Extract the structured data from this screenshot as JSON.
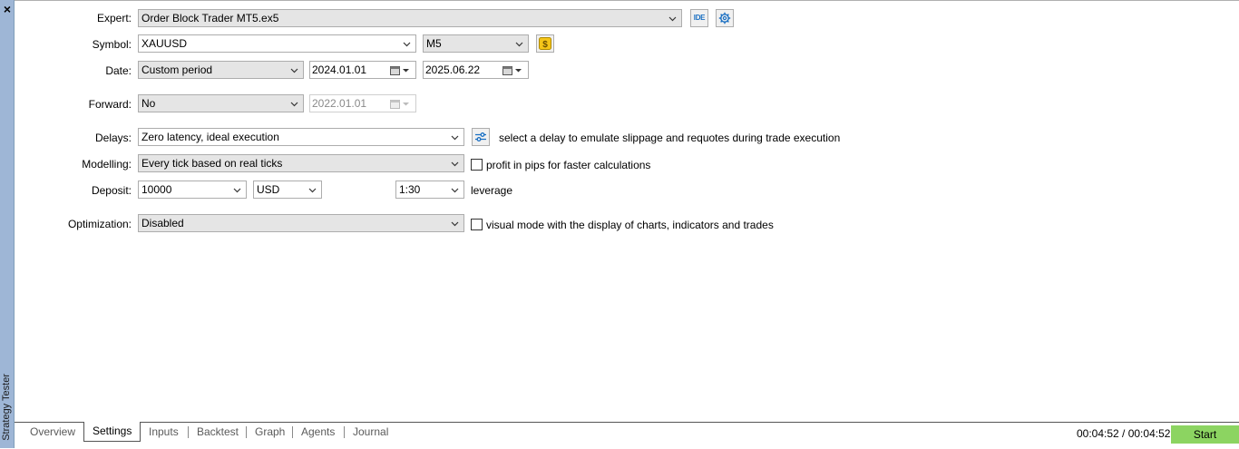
{
  "side_panel": {
    "close_symbol": "×",
    "title": "Strategy Tester"
  },
  "form": {
    "expert": {
      "label": "Expert:",
      "value": "Order Block Trader MT5.ex5",
      "ide_label": "IDE",
      "settings_icon": "gear-icon"
    },
    "symbol": {
      "label": "Symbol:",
      "value": "XAUUSD",
      "timeframe": "M5",
      "symbol_icon": "dollar-icon"
    },
    "date": {
      "label": "Date:",
      "mode": "Custom period",
      "from": "2024.01.01",
      "to": "2025.06.22"
    },
    "forward": {
      "label": "Forward:",
      "value": "No",
      "date": "2022.01.01"
    },
    "delays": {
      "label": "Delays:",
      "value": "Zero latency, ideal execution",
      "hint": "select a delay to emulate slippage and requotes during trade execution"
    },
    "modelling": {
      "label": "Modelling:",
      "value": "Every tick based on real ticks",
      "checkbox_label": "profit in pips for faster calculations",
      "checked": false
    },
    "deposit": {
      "label": "Deposit:",
      "amount": "10000",
      "currency": "USD",
      "leverage_value": "1:30",
      "leverage_label": "leverage"
    },
    "optimization": {
      "label": "Optimization:",
      "value": "Disabled",
      "checkbox_label": "visual mode with the display of charts, indicators and trades",
      "checked": false
    }
  },
  "tabs": [
    {
      "label": "Overview"
    },
    {
      "label": "Settings"
    },
    {
      "label": "Inputs"
    },
    {
      "label": "Backtest"
    },
    {
      "label": "Graph"
    },
    {
      "label": "Agents"
    },
    {
      "label": "Journal"
    }
  ],
  "active_tab": "Settings",
  "status": {
    "timer": "00:04:52 / 00:04:52",
    "start_label": "Start"
  },
  "colors": {
    "start_button": "#8cd461",
    "side_panel": "#9eb6d6",
    "accent_icon": "#1a6fc2",
    "symbol_icon_bg": "#f5c518"
  }
}
